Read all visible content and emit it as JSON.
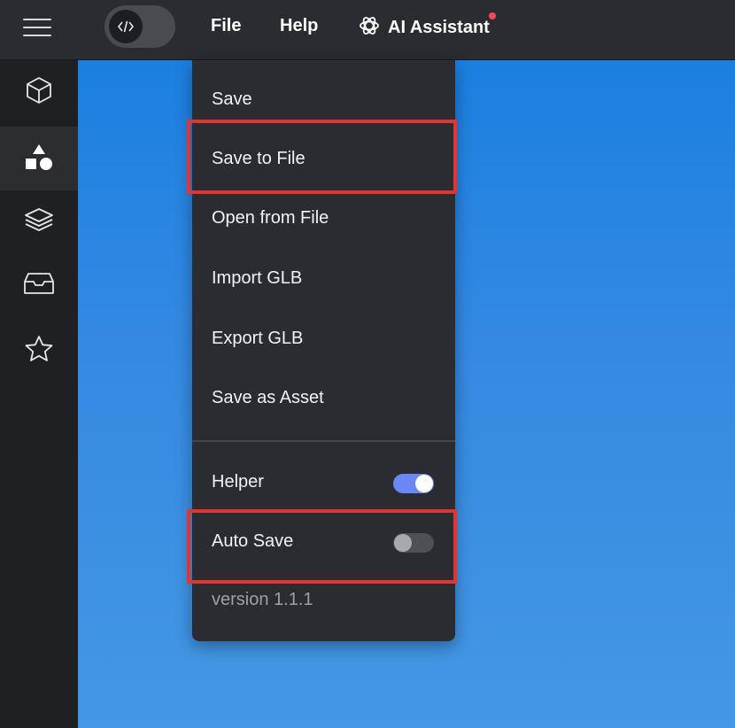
{
  "topbar": {
    "code_toggle_icon": "code-icon",
    "menu": {
      "file": "File",
      "help": "Help"
    },
    "ai_assistant": {
      "label": "AI Assistant",
      "icon": "openai-icon",
      "has_notification": true,
      "notification_color": "#ef4a5e"
    }
  },
  "sidebar": {
    "items": [
      {
        "icon": "cube-icon",
        "active": false
      },
      {
        "icon": "shapes-icon",
        "active": true
      },
      {
        "icon": "layers-icon",
        "active": false
      },
      {
        "icon": "inbox-icon",
        "active": false
      },
      {
        "icon": "star-icon",
        "active": false
      }
    ]
  },
  "file_menu": {
    "items": [
      {
        "label": "Save"
      },
      {
        "label": "Save to File",
        "highlighted": true
      },
      {
        "label": "Open from File"
      },
      {
        "label": "Import GLB"
      },
      {
        "label": "Export GLB"
      },
      {
        "label": "Save as Asset"
      }
    ],
    "toggles": [
      {
        "label": "Helper",
        "checked": true
      },
      {
        "label": "Auto Save",
        "checked": false,
        "highlighted": true
      }
    ],
    "version": "version 1.1.1"
  },
  "colors": {
    "accent_toggle_on": "#6b87f5",
    "highlight_box": "#e3342f",
    "canvas_top": "#1b7fe0",
    "canvas_bottom": "#4497e4"
  }
}
